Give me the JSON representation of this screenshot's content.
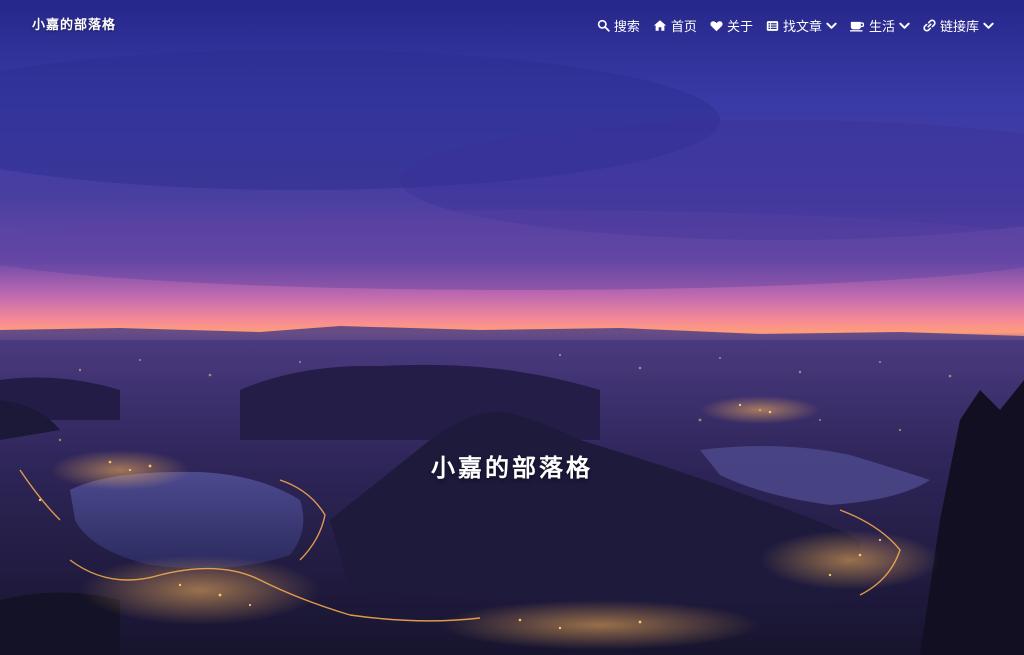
{
  "site": {
    "brand": "小嘉的部落格",
    "hero_title": "小嘉的部落格"
  },
  "nav": {
    "search": {
      "label": "搜索",
      "icon": "search-icon"
    },
    "home": {
      "label": "首页",
      "icon": "home-icon"
    },
    "about": {
      "label": "关于",
      "icon": "heart-icon"
    },
    "articles": {
      "label": "找文章",
      "icon": "list-icon"
    },
    "life": {
      "label": "生活",
      "icon": "coffee-icon"
    },
    "links": {
      "label": "链接库",
      "icon": "link-icon"
    }
  },
  "colors": {
    "nav_text": "#ffffff",
    "sky_top": "#2a2f8a",
    "horizon": "#f07a9c",
    "city_lights": "#ffb347"
  }
}
